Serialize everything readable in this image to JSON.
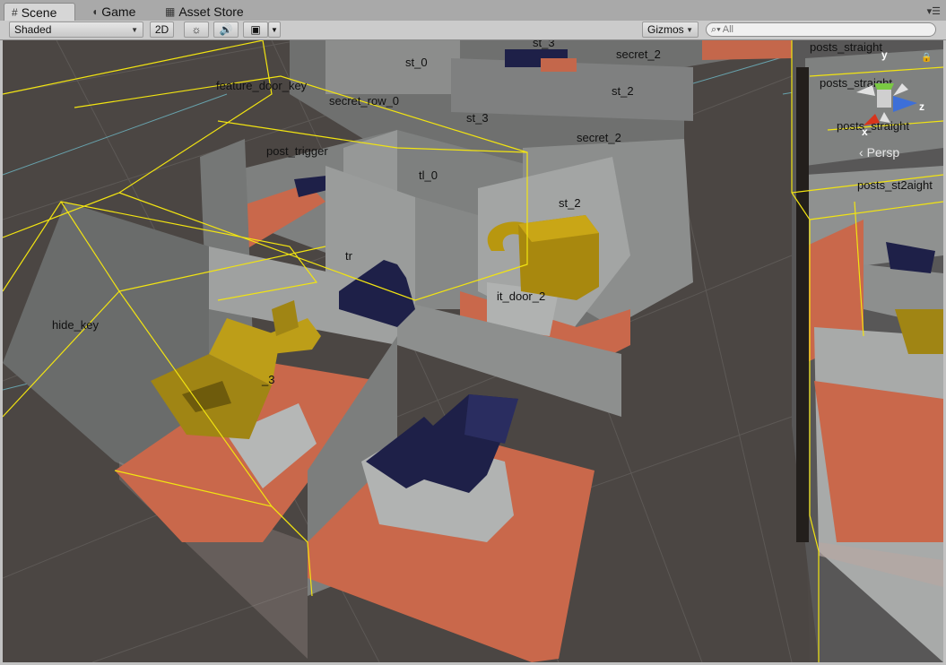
{
  "tabs": [
    {
      "label": "Scene",
      "icon": "grid-icon"
    },
    {
      "label": "Game",
      "icon": "pacman-icon"
    },
    {
      "label": "Asset Store",
      "icon": "store-icon"
    }
  ],
  "toolbar": {
    "shading_mode": "Shaded",
    "mode_2d": "2D",
    "gizmos": "Gizmos",
    "search_placeholder": "All"
  },
  "gizmo": {
    "x": "x",
    "y": "y",
    "z": "z",
    "projection": "Persp"
  },
  "labels": {
    "st_0": "st_0",
    "st_3_top": "st_3",
    "secret_2_a": "secret_2",
    "feature_door_key": "feature_door_key",
    "secret_row_0": "secret_row_0",
    "st_2": "st_2",
    "st_3": "st_3",
    "secret_2_b": "secret_2",
    "post_trigger": "post_trigger",
    "tl_0": "tl_0",
    "st_2b": "st_2",
    "tr": "tr",
    "it_door_2": "it_door_2",
    "hide_key": "hide_key",
    "m_3": "_3",
    "posts_straight_a": "posts_straight",
    "posts_straight_b": "posts_straight",
    "posts_straight_c": "posts_straight",
    "posts_straight_d": "posts_st2aight"
  },
  "colors": {
    "floor_orange": "#c9684b",
    "wall_gray": "#8f9190",
    "key_gold": "#a08514",
    "arrow_navy": "#1e2048",
    "bounds_yellow": "#f2e411"
  }
}
